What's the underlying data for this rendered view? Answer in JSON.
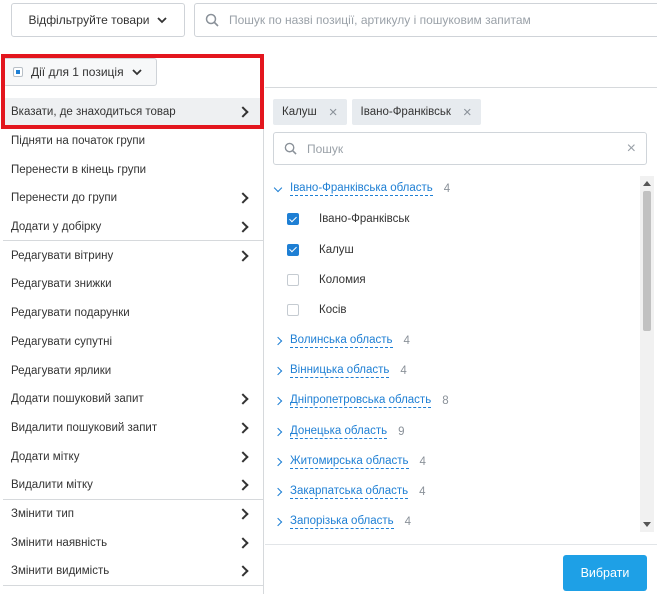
{
  "toolbar": {
    "filter_label": "Відфільтруйте товари",
    "search_placeholder": "Пошук по назві позиції, артикулу і пошуковим запитам"
  },
  "actions": {
    "label": "Дії для 1 позиція"
  },
  "menu": {
    "items": [
      {
        "label": "Вказати, де знаходиться товар",
        "submenu": true,
        "active": true
      },
      {
        "label": "Підняти на початок групи",
        "submenu": false
      },
      {
        "label": "Перенести в кінець групи",
        "submenu": false
      },
      {
        "label": "Перенести до групи",
        "submenu": true
      },
      {
        "label": "Додати у добірку",
        "submenu": true
      },
      {
        "label": "Редагувати вітрину",
        "submenu": true
      },
      {
        "label": "Редагувати знижки",
        "submenu": false
      },
      {
        "label": "Редагувати подарунки",
        "submenu": false
      },
      {
        "label": "Редагувати супутні",
        "submenu": false
      },
      {
        "label": "Редагувати ярлики",
        "submenu": false
      },
      {
        "label": "Додати пошуковий запит",
        "submenu": true
      },
      {
        "label": "Видалити пошуковий запит",
        "submenu": true
      },
      {
        "label": "Додати мітку",
        "submenu": true
      },
      {
        "label": "Видалити мітку",
        "submenu": true
      },
      {
        "label": "Змінити тип",
        "submenu": true
      },
      {
        "label": "Змінити наявність",
        "submenu": true
      },
      {
        "label": "Змінити видимість",
        "submenu": true
      }
    ]
  },
  "location": {
    "selected_tags": [
      "Калуш",
      "Івано-Франківськ"
    ],
    "search_placeholder": "Пошук",
    "regions": [
      {
        "name": "Івано-Франківська область",
        "count": "4",
        "expanded": true,
        "cities": [
          {
            "name": "Івано-Франківськ",
            "checked": true
          },
          {
            "name": "Калуш",
            "checked": true
          },
          {
            "name": "Коломия",
            "checked": false
          },
          {
            "name": "Косів",
            "checked": false
          }
        ]
      },
      {
        "name": "Волинська область",
        "count": "4"
      },
      {
        "name": "Вінницька область",
        "count": "4"
      },
      {
        "name": "Дніпропетровська область",
        "count": "8"
      },
      {
        "name": "Донецька область",
        "count": "9"
      },
      {
        "name": "Житомирська область",
        "count": "4"
      },
      {
        "name": "Закарпатська область",
        "count": "4"
      },
      {
        "name": "Запорізька область",
        "count": "4"
      }
    ],
    "choose_label": "Вибрати"
  },
  "colors": {
    "accent": "#1e7fd4",
    "button": "#1ea0e6",
    "highlight_frame": "#e3161e"
  }
}
